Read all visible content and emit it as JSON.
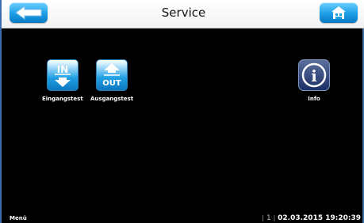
{
  "header": {
    "title": "Service"
  },
  "tiles": {
    "input_test": {
      "label": "Eingangstest",
      "icon_text": "IN"
    },
    "output_test": {
      "label": "Ausgangstest",
      "icon_text": "OUT"
    },
    "info": {
      "label": "Info",
      "icon_text": "i"
    }
  },
  "footer": {
    "menu_label": "Menü",
    "separator_left": "|",
    "page_number": "1",
    "separator_right": "|",
    "datetime": "02.03.2015 19:20:39"
  },
  "colors": {
    "accent_blue": "#1c9ee6",
    "background": "#000000",
    "header_bg": "#ffffff",
    "info_navy": "#1d2f66"
  }
}
